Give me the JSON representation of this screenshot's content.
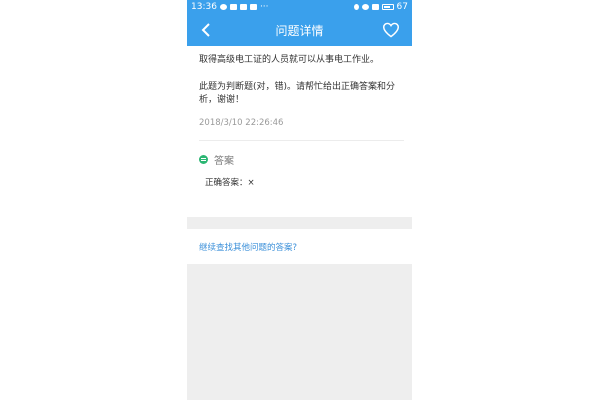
{
  "status_bar": {
    "time": "13:36",
    "more": "···",
    "battery": "67"
  },
  "nav": {
    "title": "问题详情",
    "back_icon": "chevron-left-icon",
    "fav_icon": "heart-icon"
  },
  "question": {
    "text": "取得高级电工证的人员就可以从事电工作业。",
    "note": "此题为判断题(对，错)。请帮忙给出正确答案和分析，谢谢！",
    "time": "2018/3/10 22:26:46"
  },
  "answer": {
    "title": "答案",
    "content": "正确答案：×",
    "icon_color": "#2bb673"
  },
  "more_link": "继续查找其他问题的答案?",
  "colors": {
    "accent": "#3aa0ec",
    "link": "#3a8fd9",
    "background_gray": "#eeeeee"
  }
}
